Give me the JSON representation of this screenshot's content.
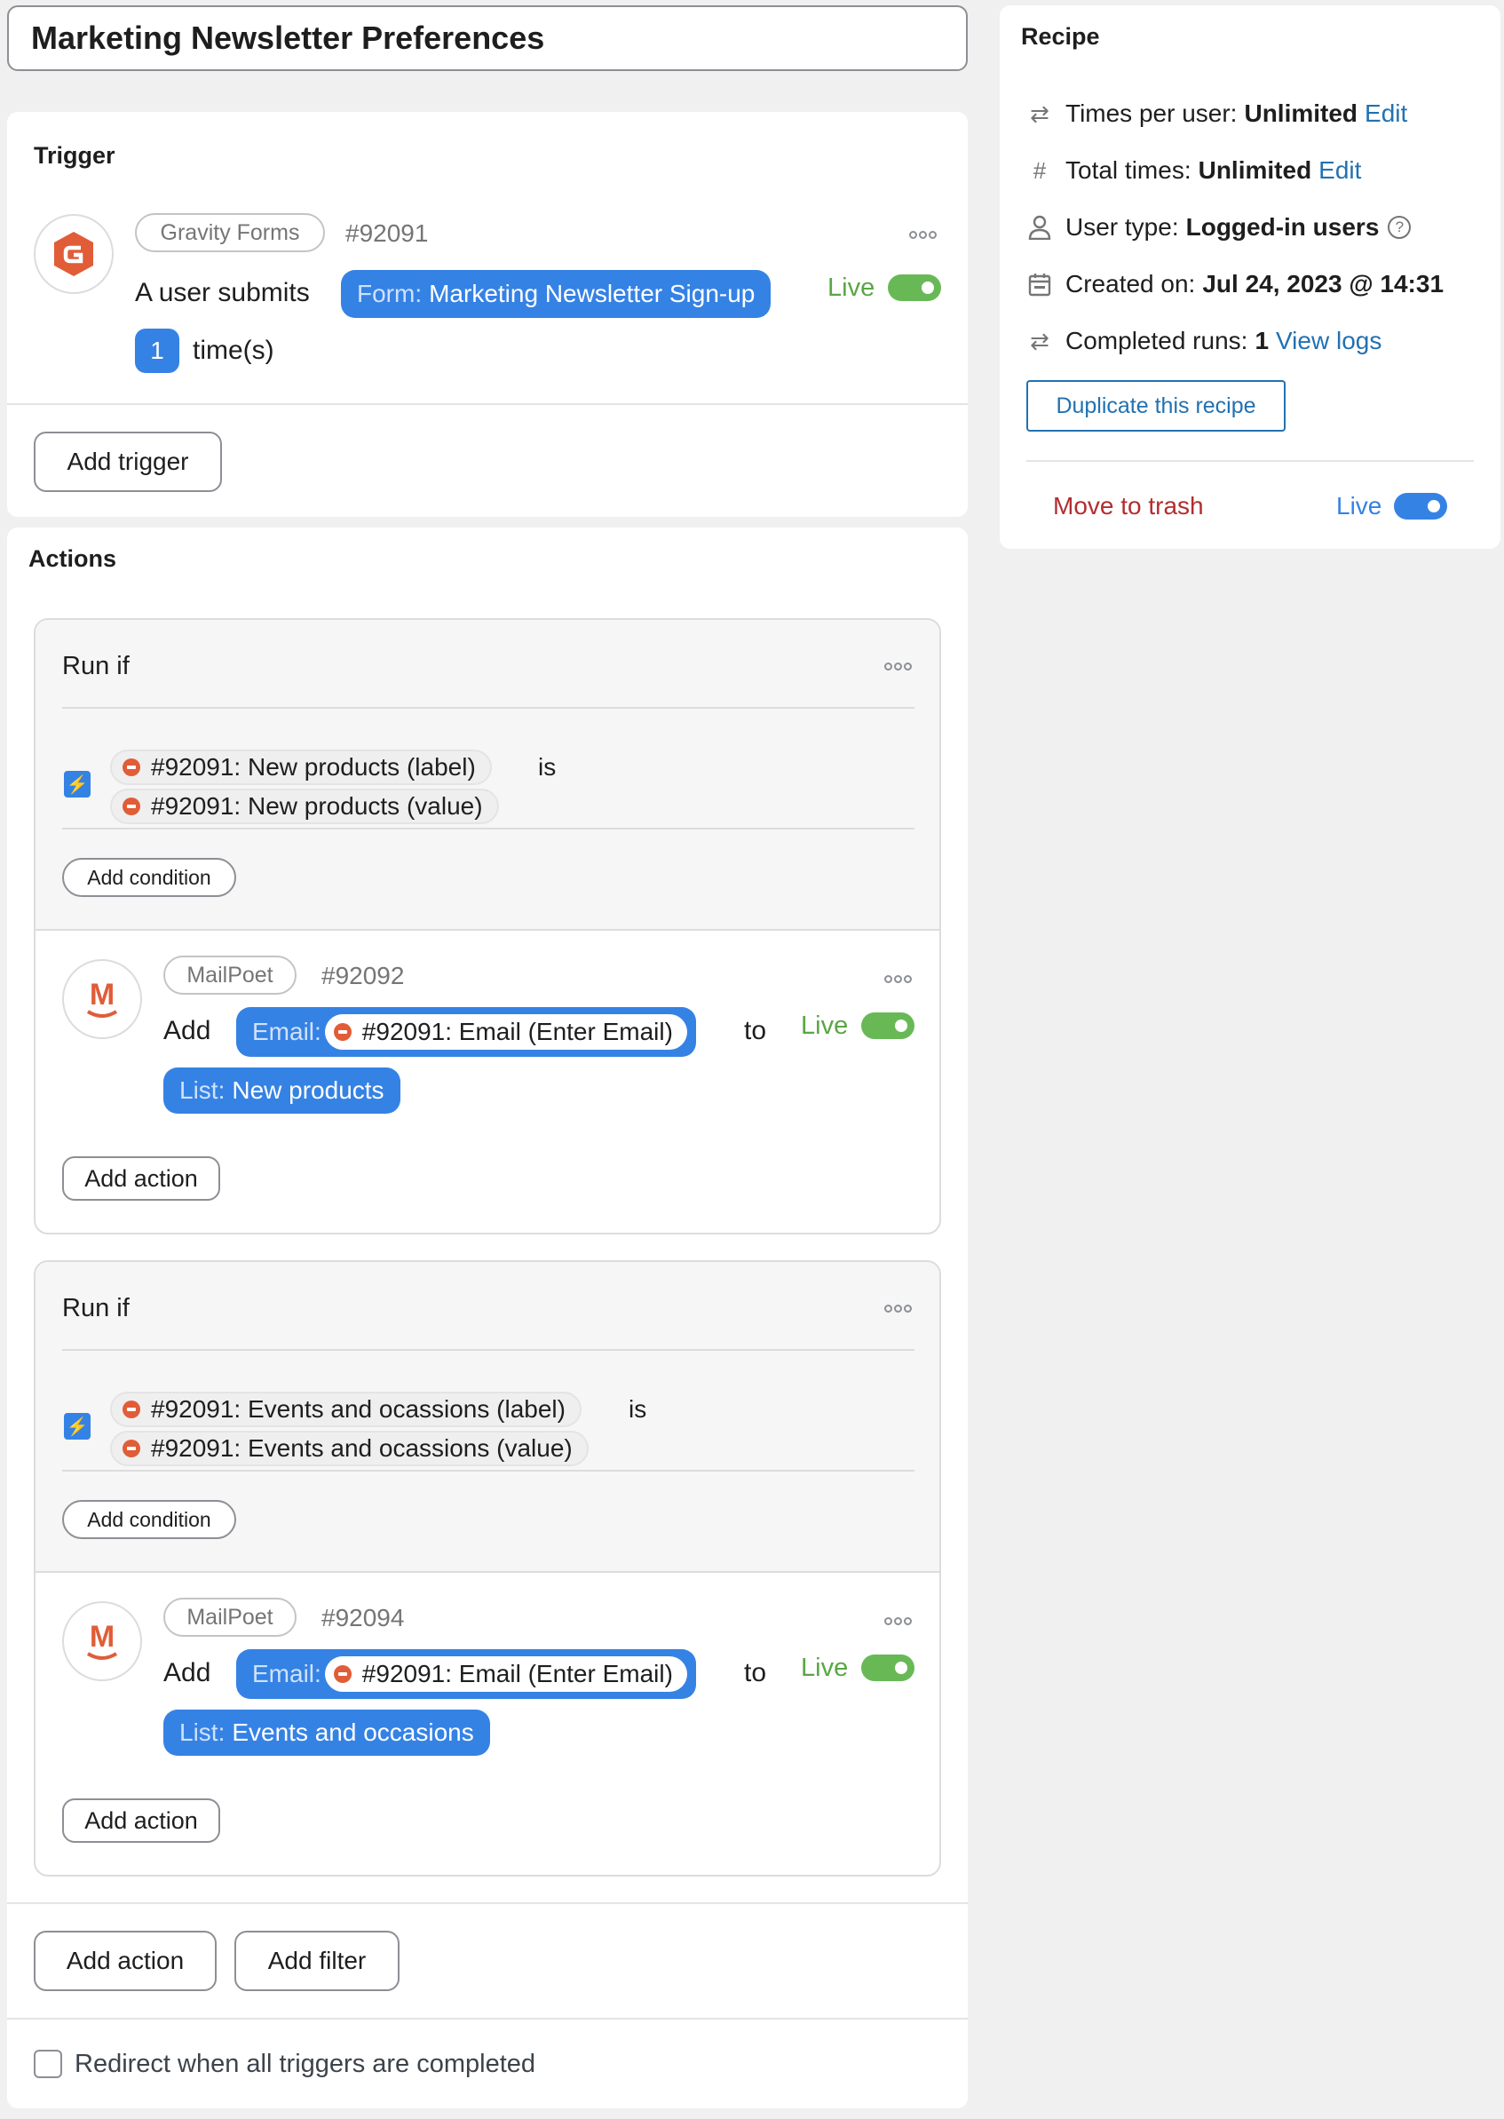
{
  "recipe_title": "Marketing Newsletter Preferences",
  "trigger_panel": {
    "heading": "Trigger",
    "integration": "Gravity Forms",
    "id": "#92091",
    "sentence_prefix": "A user submits",
    "form_key": "Form:",
    "form_value": "Marketing Newsletter Sign-up",
    "count": "1",
    "count_suffix": "time(s)",
    "status": "Live",
    "add_trigger": "Add trigger"
  },
  "actions_panel": {
    "heading": "Actions",
    "groups": [
      {
        "run_if": "Run if",
        "condition_left": "#92091: New products (label)",
        "operator": "is",
        "condition_right": "#92091: New products (value)",
        "add_condition": "Add condition",
        "action": {
          "integration": "MailPoet",
          "id": "#92092",
          "verb": "Add",
          "email_key": "Email:",
          "email_value": "#92091: Email (Enter Email)",
          "to": "to",
          "list_key": "List:",
          "list_value": "New products",
          "status": "Live"
        },
        "add_action": "Add action"
      },
      {
        "run_if": "Run if",
        "condition_left": "#92091: Events and ocassions (label)",
        "operator": "is",
        "condition_right": "#92091: Events and ocassions (value)",
        "add_condition": "Add condition",
        "action": {
          "integration": "MailPoet",
          "id": "#92094",
          "verb": "Add",
          "email_key": "Email:",
          "email_value": "#92091: Email (Enter Email)",
          "to": "to",
          "list_key": "List:",
          "list_value": "Events and occasions",
          "status": "Live"
        },
        "add_action": "Add action"
      }
    ],
    "add_action": "Add action",
    "add_filter": "Add filter",
    "redirect_label": "Redirect when all triggers are completed"
  },
  "sidebar": {
    "heading": "Recipe",
    "times_per_user_label": "Times per user:",
    "times_per_user_value": "Unlimited",
    "total_times_label": "Total times:",
    "total_times_value": "Unlimited",
    "edit": "Edit",
    "user_type_label": "User type:",
    "user_type_value": "Logged-in users",
    "created_label": "Created on:",
    "created_value": "Jul 24, 2023 @ 14:31",
    "completed_label": "Completed runs:",
    "completed_value": "1",
    "view_logs": "View logs",
    "duplicate": "Duplicate this recipe",
    "trash": "Move to trash",
    "status": "Live"
  },
  "icons": {
    "gravity_forms": "gravity-forms-logo",
    "mailpoet": "mailpoet-logo",
    "repeat": "repeat-icon",
    "hash": "hash-icon",
    "user": "user-icon",
    "calendar": "calendar-icon",
    "help": "help-icon",
    "bolt": "bolt-icon"
  },
  "colors": {
    "accent_blue": "#3582e5",
    "live_green": "#5aa645",
    "trash_red": "#b32d2e",
    "link_blue": "#2271b1",
    "gravity_orange": "#e05d38"
  }
}
